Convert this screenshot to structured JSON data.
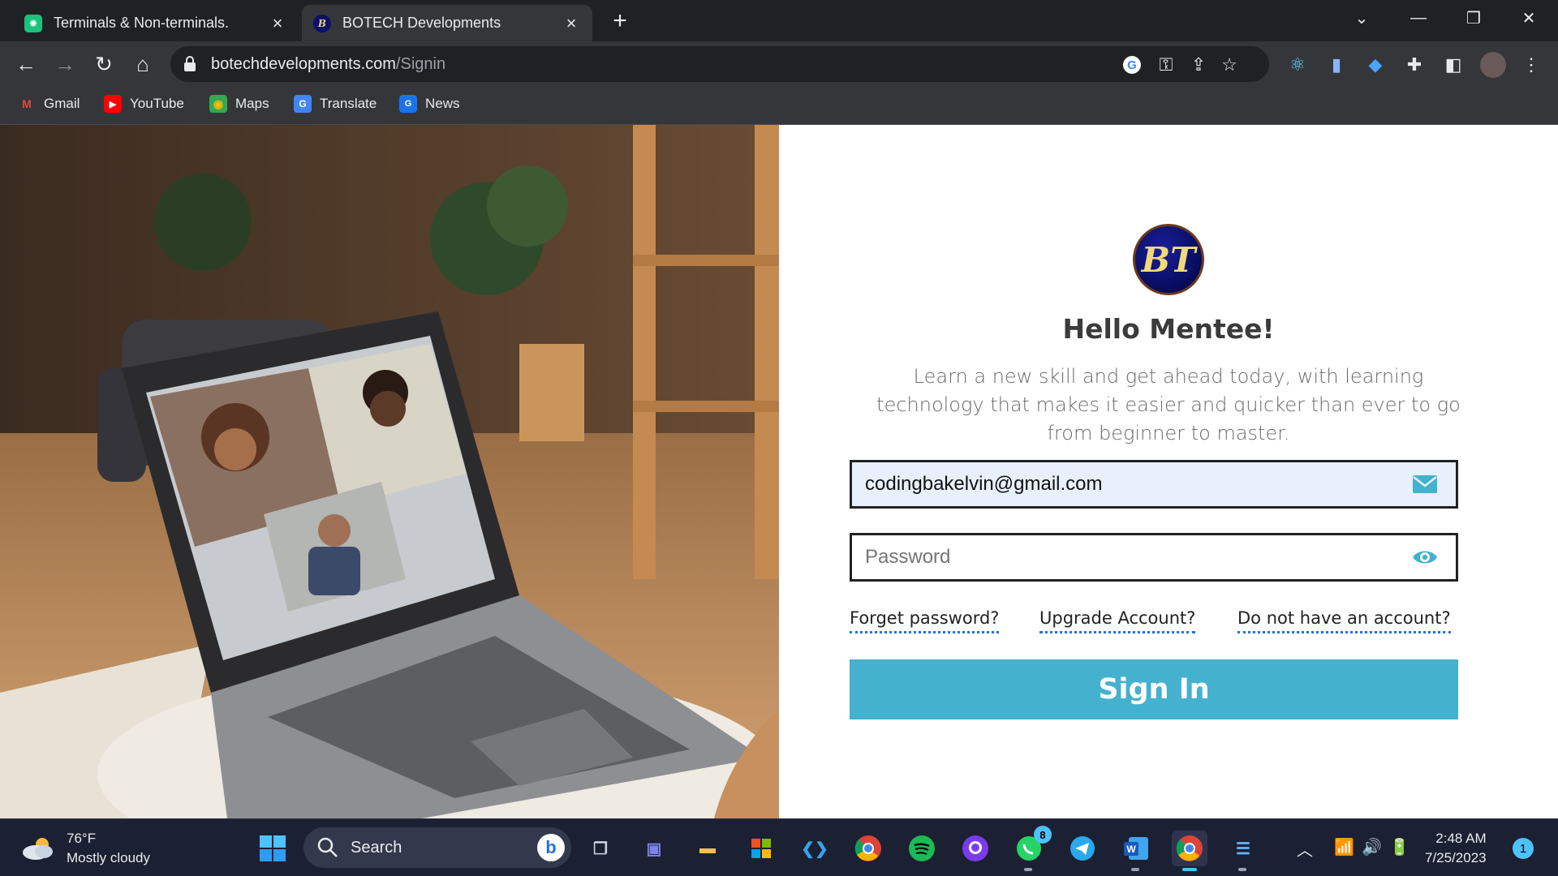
{
  "browser": {
    "tabs": [
      {
        "title": "Terminals & Non-terminals.",
        "active": false
      },
      {
        "title": "BOTECH Developments",
        "active": true
      }
    ],
    "address": {
      "domain": "botechdevelopments.com",
      "path": "/Signin"
    },
    "bookmarks": [
      "Gmail",
      "YouTube",
      "Maps",
      "Translate",
      "News"
    ]
  },
  "login": {
    "logo_text": "BT",
    "heading": "Hello Mentee!",
    "intro": "Learn a new skill and get ahead today, with learning technology that makes it easier and quicker than ever to go from beginner to master.",
    "email_value": "codingbakelvin@gmail.com",
    "password_placeholder": "Password",
    "links": {
      "forgot": "Forget password?",
      "upgrade": "Upgrade Account?",
      "no_account": "Do not have an account?"
    },
    "signin_label": "Sign In",
    "accent_color": "#44b1cf"
  },
  "taskbar": {
    "weather_temp": "76°F",
    "weather_desc": "Mostly cloudy",
    "search_label": "Search",
    "whatsapp_badge": "8",
    "time": "2:48 AM",
    "date": "7/25/2023",
    "notifications": "1"
  }
}
